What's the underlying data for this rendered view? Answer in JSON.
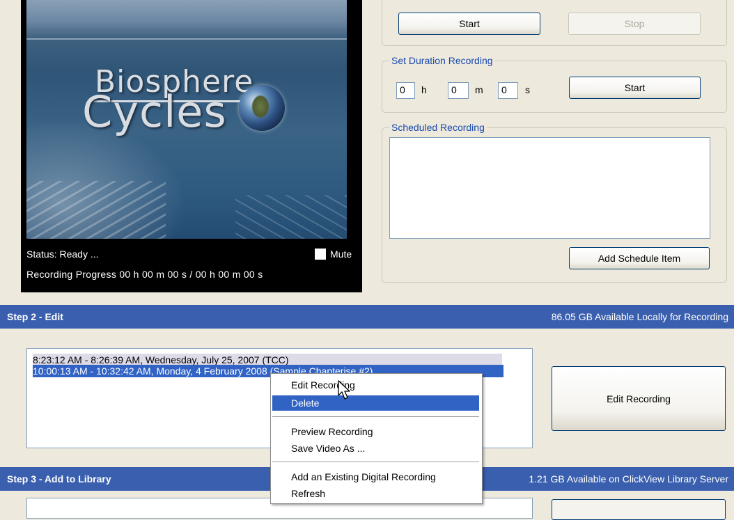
{
  "video": {
    "title_line1": "Biosphere",
    "title_line2": "Cycles",
    "status": "Status: Ready ...",
    "mute_label": "Mute",
    "progress": "Recording Progress 00 h 00 m 00 s /  00 h 00 m 00 s"
  },
  "manual": {
    "start_label": "Start",
    "stop_label": "Stop"
  },
  "duration": {
    "title": "Set Duration Recording",
    "hours": "0",
    "minutes": "0",
    "seconds": "0",
    "h_unit": "h",
    "m_unit": "m",
    "s_unit": "s",
    "start_label": "Start"
  },
  "scheduled": {
    "title": "Scheduled Recording",
    "add_label": "Add Schedule Item"
  },
  "step2": {
    "title": "Step 2 - Edit",
    "available": "86.05 GB Available Locally for Recording",
    "recordings": [
      "8:23:12 AM - 8:26:39 AM, Wednesday, July 25, 2007 (TCC)",
      "10:00:13 AM - 10:32:42 AM, Monday, 4 February 2008 (Sample Chapterise #2)"
    ],
    "edit_button_label": "Edit Recording"
  },
  "context_menu": {
    "items": [
      "Edit Recording",
      "Delete",
      "Preview Recording",
      "Save Video As ...",
      "Add an Existing Digital Recording",
      "Refresh"
    ]
  },
  "step3": {
    "title": "Step 3 - Add to Library",
    "available": "1.21 GB Available on ClickView Library Server"
  },
  "colors": {
    "step_bar": "#3a5fae",
    "selection": "#3163c5",
    "group_title": "#1a4ab0"
  }
}
